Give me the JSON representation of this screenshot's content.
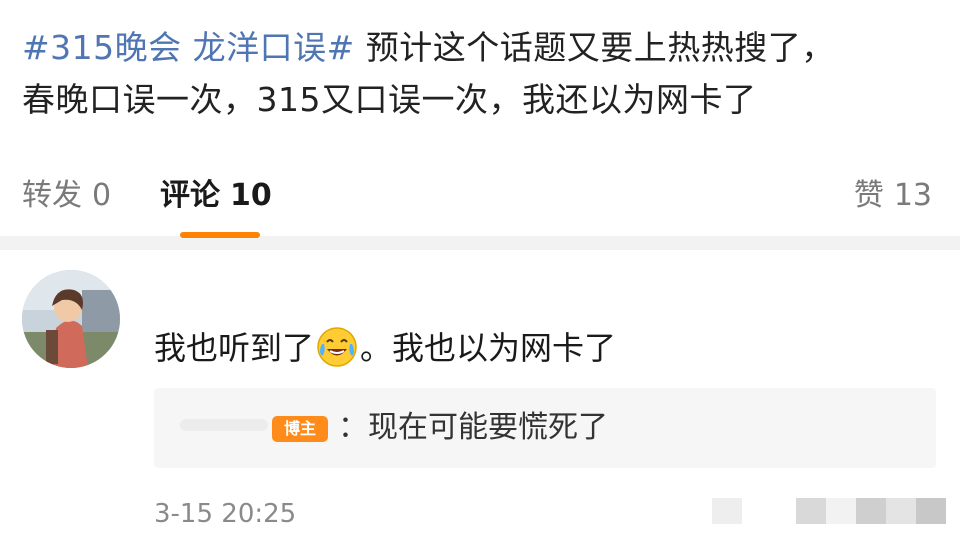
{
  "post": {
    "hashtag": "#315晚会 龙洋口误#",
    "text_line1_rest": " 预计这个话题又要上热热搜了，",
    "text_line2": "春晚口误一次，315又口误一次，我还以为网卡了"
  },
  "actions": {
    "repost_label": "转发",
    "repost_count": "0",
    "comment_label": "评论",
    "comment_count": "10",
    "like_label": "赞",
    "like_count": "13"
  },
  "comment": {
    "text_before_emoji": "我也听到了",
    "emoji_icon": "laughing-tears-emoji",
    "text_after_emoji": "。我也以为网卡了",
    "timestamp": "3-15 20:25"
  },
  "reply": {
    "badge": "博主",
    "text": "：现在可能要慌死了"
  },
  "colors": {
    "hashtag": "#4f76b3",
    "accent": "#ff8200",
    "badge": "#ff8c1a"
  }
}
